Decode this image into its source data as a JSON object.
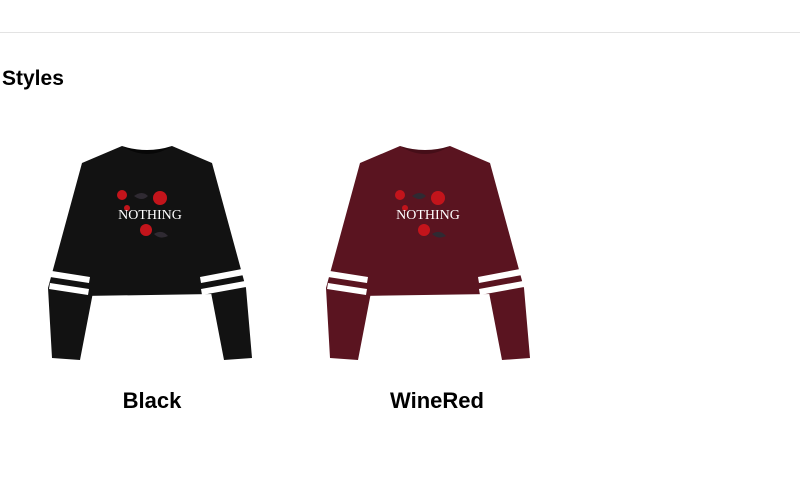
{
  "section": {
    "title": "Styles"
  },
  "products": [
    {
      "label": "Black",
      "print_text": "NOTHING",
      "body_color": "#121212",
      "shade_color": "#070707"
    },
    {
      "label": "WineRed",
      "print_text": "NOTHING",
      "body_color": "#5a1420",
      "shade_color": "#450e18"
    }
  ],
  "colors": {
    "stripe": "#ffffff",
    "rose": "#c3141b",
    "leaf": "#2f2a32",
    "print_text": "#ffffff"
  }
}
